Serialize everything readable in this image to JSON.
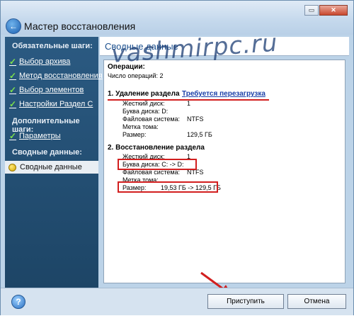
{
  "window": {
    "title": "Мастер восстановления"
  },
  "sidebar": {
    "required_heading": "Обязательные шаги:",
    "required_items": [
      {
        "label": "Выбор архива"
      },
      {
        "label": "Метод восстановления"
      },
      {
        "label": "Выбор элементов"
      },
      {
        "label": "Настройки Раздел С"
      }
    ],
    "additional_heading": "Дополнительные шаги:",
    "additional_items": [
      {
        "label": "Параметры"
      }
    ],
    "summary_heading": "Сводные данные:",
    "active_item": "Сводные данные"
  },
  "page_title": "Сводные данные",
  "operations": {
    "heading": "Операции:",
    "count_label": "Число операций: 2",
    "op1": {
      "title": "1. Удаление раздела",
      "reboot_note": "Требуется перезагрузка",
      "fields": [
        {
          "label": "Жесткий диск:",
          "value": "1"
        },
        {
          "label": "Буква диска: D:",
          "value": ""
        },
        {
          "label": "Файловая система:",
          "value": "NTFS"
        },
        {
          "label": "Метка тома:",
          "value": ""
        },
        {
          "label": "Размер:",
          "value": "129,5 ГБ"
        }
      ]
    },
    "op2": {
      "title": "2. Восстановление раздела",
      "fields": [
        {
          "label": "Жесткий диск:",
          "value": "1"
        },
        {
          "label": "Буква диска: C: -> D:",
          "value": ""
        },
        {
          "label": "Файловая система:",
          "value": "NTFS"
        },
        {
          "label": "Метка тома:",
          "value": ""
        },
        {
          "label": "Размер:",
          "value": "19,53 ГБ -> 129,5 ГБ"
        }
      ]
    }
  },
  "watermark": "vashmirpc.ru",
  "buttons": {
    "proceed": "Приступить",
    "cancel": "Отмена"
  },
  "icons": {
    "back": "back-arrow-icon",
    "help": "help-icon",
    "check": "checkmark-icon"
  },
  "colors": {
    "annotation_red": "#d21f1f",
    "sidebar": "#2b5a82",
    "link": "#1a3fa8"
  }
}
